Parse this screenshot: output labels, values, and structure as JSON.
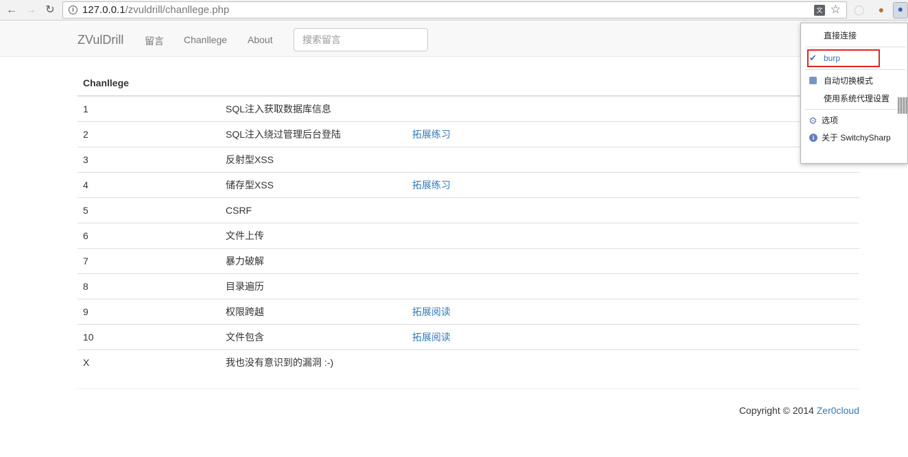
{
  "browser": {
    "url_host": "127.0.0.1",
    "url_path": "/zvuldrill/chanllege.php",
    "translate_icon": "translate-icon",
    "star_icon": "star-icon"
  },
  "navbar": {
    "brand": "ZVulDrill",
    "links": [
      "留言",
      "Chanllege",
      "About"
    ],
    "search_placeholder": "搜索留言"
  },
  "table": {
    "header": "Chanllege",
    "rows": [
      {
        "id": "1",
        "title": "SQL注入获取数据库信息",
        "link": ""
      },
      {
        "id": "2",
        "title": "SQL注入绕过管理后台登陆",
        "link": "拓展练习"
      },
      {
        "id": "3",
        "title": "反射型XSS",
        "link": ""
      },
      {
        "id": "4",
        "title": "储存型XSS",
        "link": "拓展练习"
      },
      {
        "id": "5",
        "title": "CSRF",
        "link": ""
      },
      {
        "id": "6",
        "title": "文件上传",
        "link": ""
      },
      {
        "id": "7",
        "title": "暴力破解",
        "link": ""
      },
      {
        "id": "8",
        "title": "目录遍历",
        "link": ""
      },
      {
        "id": "9",
        "title": "权限跨越",
        "link": "拓展阅读"
      },
      {
        "id": "10",
        "title": "文件包含",
        "link": "拓展阅读"
      },
      {
        "id": "X",
        "title": "我也没有意识到的漏洞 :-)",
        "link": ""
      }
    ]
  },
  "footer": {
    "copyright": "Copyright © 2014",
    "author": "Zer0cloud"
  },
  "proxy_menu": {
    "direct": "直接连接",
    "burp": "burp",
    "auto_switch": "自动切换模式",
    "system_proxy": "使用系统代理设置",
    "options": "选项",
    "about": "关于 SwitchySharp"
  },
  "colors": {
    "link": "#337ab7",
    "highlight": "#e02424"
  }
}
